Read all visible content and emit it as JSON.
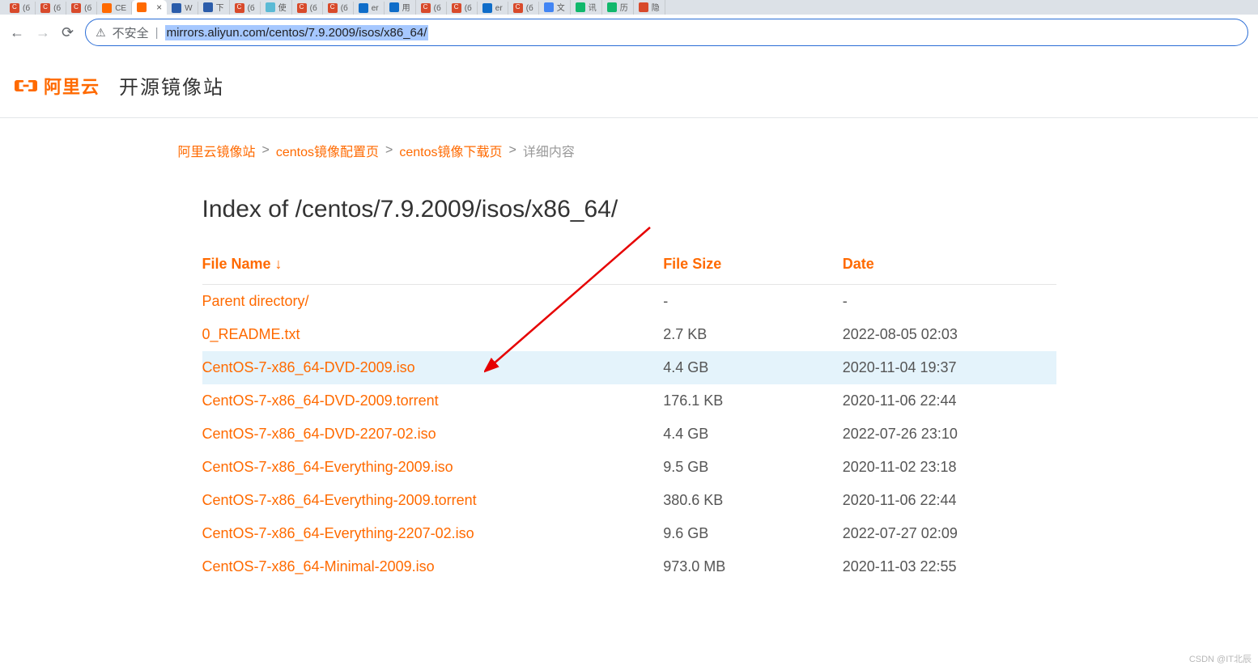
{
  "browser": {
    "tabs": [
      {
        "label": "(б",
        "type": "c"
      },
      {
        "label": "(б",
        "type": "c"
      },
      {
        "label": "(б",
        "type": "c"
      },
      {
        "label": "CE",
        "type": "orange"
      },
      {
        "label": "",
        "type": "orange",
        "active": true
      },
      {
        "label": "W",
        "type": "blue"
      },
      {
        "label": "下",
        "type": "blue"
      },
      {
        "label": "(б",
        "type": "c"
      },
      {
        "label": "使",
        "type": "teal"
      },
      {
        "label": "(б",
        "type": "c"
      },
      {
        "label": "(б",
        "type": "c"
      },
      {
        "label": "er",
        "type": "dblue"
      },
      {
        "label": "用",
        "type": "dblue"
      },
      {
        "label": "(б",
        "type": "c"
      },
      {
        "label": "(б",
        "type": "c"
      },
      {
        "label": "er",
        "type": "dblue"
      },
      {
        "label": "(б",
        "type": "c"
      },
      {
        "label": "文",
        "type": "ms"
      },
      {
        "label": "讯",
        "type": "s360"
      },
      {
        "label": "历",
        "type": "s360"
      },
      {
        "label": "隐",
        "type": ""
      }
    ],
    "insecure_label": "不安全",
    "url": "mirrors.aliyun.com/centos/7.9.2009/isos/x86_64/"
  },
  "header": {
    "logo_text": "阿里云",
    "site_title": "开源镜像站"
  },
  "breadcrumb": {
    "items": [
      {
        "text": "阿里云镜像站",
        "link": true
      },
      {
        "text": "centos镜像配置页",
        "link": true
      },
      {
        "text": "centos镜像下载页",
        "link": true
      },
      {
        "text": "详细内容",
        "link": false
      }
    ]
  },
  "listing": {
    "title": "Index of /centos/7.9.2009/isos/x86_64/",
    "columns": {
      "name": "File Name ↓",
      "size": "File Size",
      "date": "Date"
    },
    "rows": [
      {
        "name": "Parent directory/",
        "size": "-",
        "date": "-",
        "highlight": false
      },
      {
        "name": "0_README.txt",
        "size": "2.7 KB",
        "date": "2022-08-05 02:03",
        "highlight": false
      },
      {
        "name": "CentOS-7-x86_64-DVD-2009.iso",
        "size": "4.4 GB",
        "date": "2020-11-04 19:37",
        "highlight": true
      },
      {
        "name": "CentOS-7-x86_64-DVD-2009.torrent",
        "size": "176.1 KB",
        "date": "2020-11-06 22:44",
        "highlight": false
      },
      {
        "name": "CentOS-7-x86_64-DVD-2207-02.iso",
        "size": "4.4 GB",
        "date": "2022-07-26 23:10",
        "highlight": false
      },
      {
        "name": "CentOS-7-x86_64-Everything-2009.iso",
        "size": "9.5 GB",
        "date": "2020-11-02 23:18",
        "highlight": false
      },
      {
        "name": "CentOS-7-x86_64-Everything-2009.torrent",
        "size": "380.6 KB",
        "date": "2020-11-06 22:44",
        "highlight": false
      },
      {
        "name": "CentOS-7-x86_64-Everything-2207-02.iso",
        "size": "9.6 GB",
        "date": "2022-07-27 02:09",
        "highlight": false
      },
      {
        "name": "CentOS-7-x86_64-Minimal-2009.iso",
        "size": "973.0 MB",
        "date": "2020-11-03 22:55",
        "highlight": false
      }
    ]
  },
  "watermark": "CSDN @IT北辰"
}
